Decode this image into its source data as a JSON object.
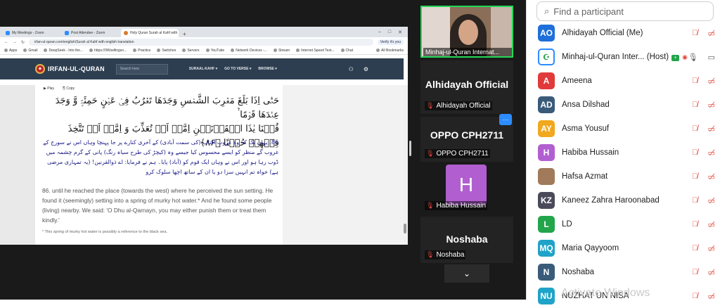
{
  "browser": {
    "tabs": [
      {
        "label": "My Meetings - Zoom",
        "active": false
      },
      {
        "label": "Post Attendee - Zoom",
        "active": false
      },
      {
        "label": "Holy Quran Surah al Kahf with",
        "active": true
      }
    ],
    "new_tab": "+",
    "window_controls": [
      "–",
      "□",
      "✕"
    ],
    "url": "irfan-ul-quran.com/english/Surah al Kahf with english translation",
    "verify_label": "Verify it's you",
    "bookmarks": [
      "Apps",
      "Gmail",
      "DeepSeek - Into the...",
      "https://3Wsellingvo...",
      "Practice",
      "Switches",
      "Servers",
      "YouTube",
      "Network Devices -...",
      "Stream",
      "Internet Speed Test...",
      "Chat"
    ],
    "all_bookmarks": "All Bookmarks"
  },
  "site": {
    "logo": "IRFAN-UL-QURAN",
    "search_placeholder": "Search here",
    "nav": [
      "SURAAL-KAHF ▾",
      "GO TO VERSE ▾",
      "BROWSE ▾"
    ],
    "play": "▶ Play",
    "copy": "⎘ Copy",
    "arabic_line1": "حَتّٰۤی اِذَا بَلَغَ مَغۡرِبَ الشَّمۡسِ وَجَدَهَا تَغۡرُبُ فِیۡ عَیۡنٍ حَمِئَۃٍ وَّ وَجَدَ عِنۡدَهَا قَوۡمًا ۬ؕ",
    "arabic_line2": "قُلۡنَا یٰذَا الۡقَرۡنَیۡنِ اِمَّاۤ اَنۡ تُعَذِّبَ وَ اِمَّاۤ اَنۡ تَتَّخِذَ فِیۡهِمۡ حُسۡنًا ﴿۸۶﴾",
    "urdu": "86. یہاں تک کہ وہ غروبِ آفتاب (کی سمت آبادی) کے آخری کنارے پر جا پہنچا وہاں اس نے سورج کے غروب کے منظر کو ایسے محسوس کیا جیسے وہ (کیچڑ کی طرح سیاہ رنگ) پانی کے گرم چشمہ میں ڈوب رہا ہو اور اس نے وہاں ایک قوم کو (آباد) پایا۔ ہم نے فرمایا: اے ذوالقرنین! (یہ تمہاری مرضی ہے) خواہ تم انہیں سزا دو یا ان کے ساتھ اچھا سلوک کرو",
    "english": "86. until he reached the place (towards the west) where he perceived the sun setting. He found it (seemingly) setting into a spring of murky hot water.* And he found some people (living) nearby. We said: 'O Dhu al-Qarnayn, you may either punish them or treat them kindly.'",
    "note": "* This spring of murky hot water is possibly a reference to the black sea.",
    "fab": "⌃"
  },
  "gallery": {
    "video_label": "Minhaj-ul-Quran Internat...",
    "tiles": [
      {
        "name": "Alhidayah Official",
        "label": "Alhidayah Official"
      },
      {
        "name": "OPPO CPH2711",
        "label": "OPPO CPH2711"
      },
      {
        "name": "",
        "label": "Habiba Hussain",
        "initial": "H"
      },
      {
        "name": "Noshaba",
        "label": "Noshaba"
      }
    ],
    "more": "···",
    "pager": "⌄"
  },
  "participants": {
    "search_placeholder": "Find a participant",
    "list": [
      {
        "initials": "AO",
        "name": "Alhidayah Official (Me)",
        "color": "#1e6fd9"
      },
      {
        "initials": "",
        "name": "Minhaj-ul-Quran Inter... (Host)",
        "color": "#ffffff"
      },
      {
        "initials": "A",
        "name": "Ameena",
        "color": "#e03a3a"
      },
      {
        "initials": "AD",
        "name": "Ansa Dilshad",
        "color": "#3a5a7a"
      },
      {
        "initials": "AY",
        "name": "Asma Yousuf",
        "color": "#f0a81e"
      },
      {
        "initials": "H",
        "name": "Habiba Hussain",
        "color": "#b15fd0"
      },
      {
        "initials": "",
        "name": "Hafsa Azmat",
        "color": "#a07a5a"
      },
      {
        "initials": "KZ",
        "name": "Kaneez Zahra Haroonabad",
        "color": "#4a4a5a"
      },
      {
        "initials": "L",
        "name": "LD",
        "color": "#23a54b"
      },
      {
        "initials": "MQ",
        "name": "Maria Qayyoom",
        "color": "#1fa3c8"
      },
      {
        "initials": "N",
        "name": "Noshaba",
        "color": "#3a5a7a"
      },
      {
        "initials": "NU",
        "name": "NUZHAT UN NISA",
        "color": "#1fa3c8"
      }
    ],
    "host_badge": "+"
  },
  "watermark": "Activate Windows"
}
